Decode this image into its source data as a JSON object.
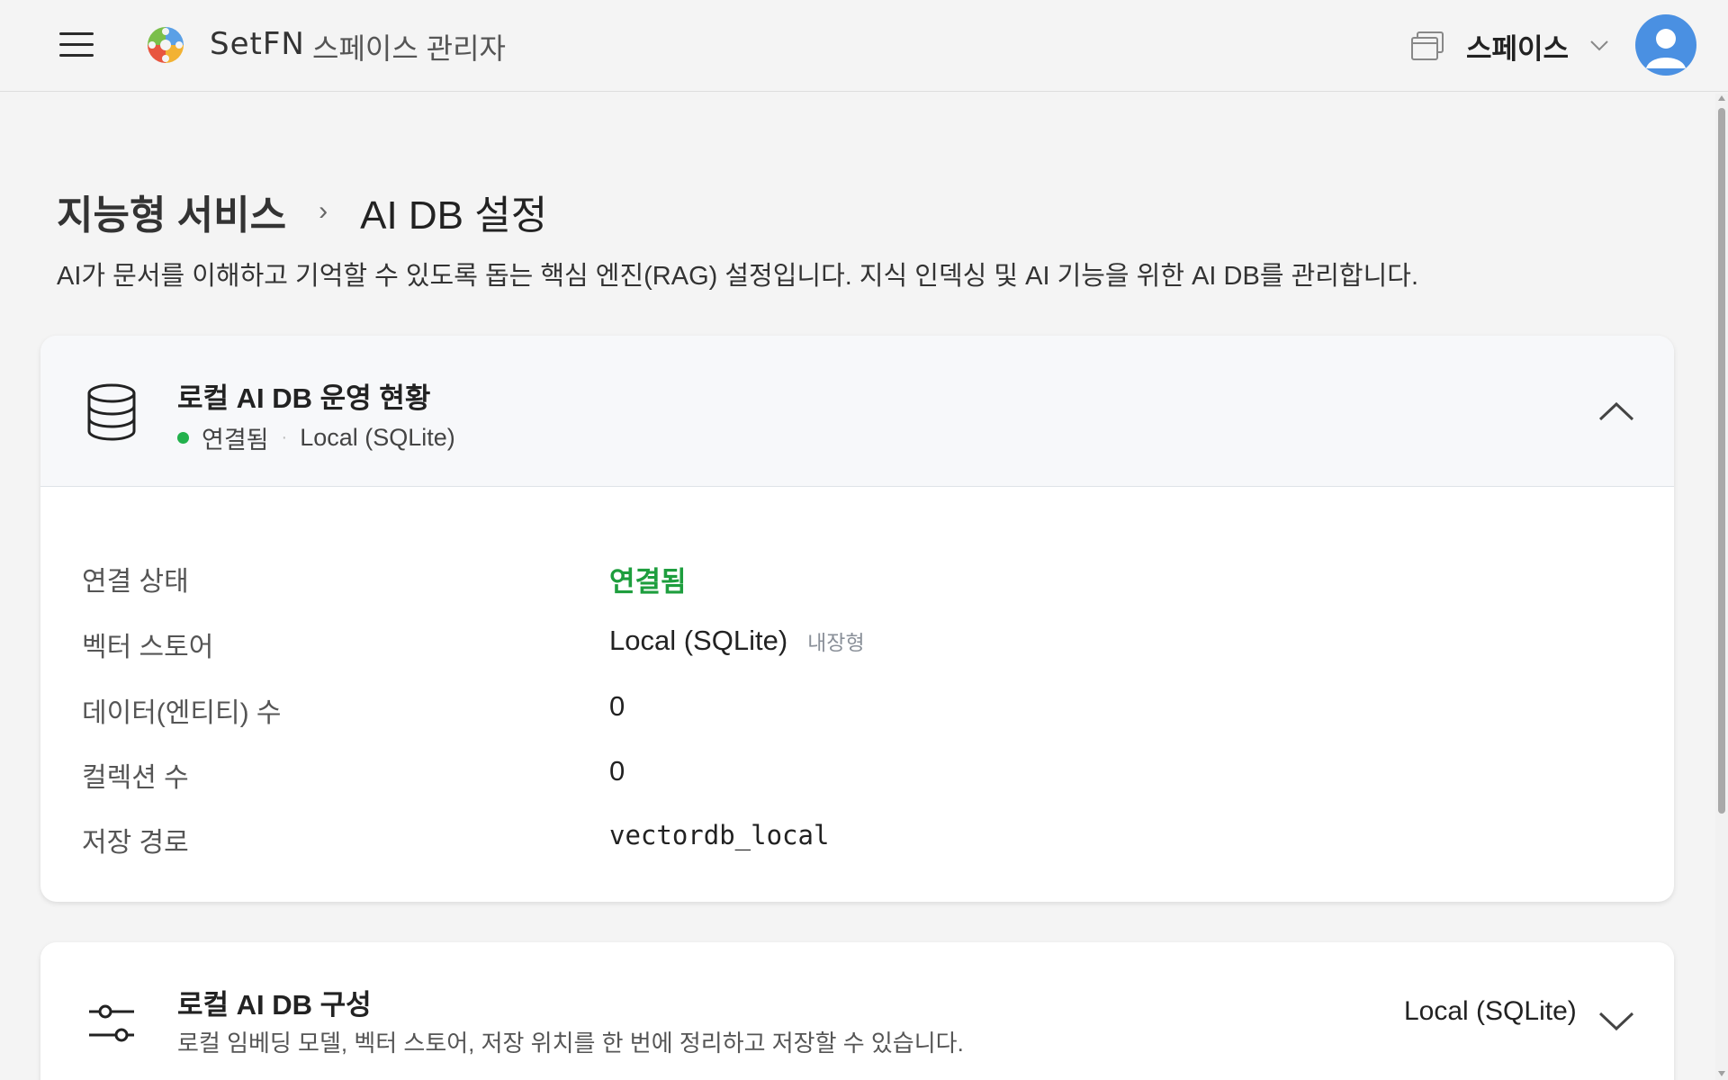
{
  "header": {
    "brand_name": "SetFN",
    "brand_sub": "스페이스 관리자",
    "space_label": "스페이스",
    "icons": [
      "menu-icon",
      "logo-icon",
      "window-stack-icon",
      "chevron-down-icon",
      "user-avatar-icon"
    ]
  },
  "breadcrumb": {
    "parent": "지능형 서비스",
    "separator": "›",
    "current": "AI DB 설정"
  },
  "description": "AI가 문서를 이해하고 기억할 수 있도록 돕는 핵심 엔진(RAG) 설정입니다. 지식 인덱싱 및 AI 기능을 위한 AI DB를 관리합니다.",
  "status_card": {
    "title": "로컬 AI DB 운영 현황",
    "status_text": "연결됨",
    "status_sep": "·",
    "backend": "Local (SQLite)",
    "status_color": "#22b14c",
    "rows": [
      {
        "label": "연결 상태",
        "value": "연결됨",
        "tag": ""
      },
      {
        "label": "벡터 스토어",
        "value": "Local (SQLite)",
        "tag": "내장형"
      },
      {
        "label": "데이터(엔티티) 수",
        "value": "0",
        "tag": ""
      },
      {
        "label": "컬렉션 수",
        "value": "0",
        "tag": ""
      },
      {
        "label": "저장 경로",
        "value": "vectordb_local",
        "tag": ""
      }
    ],
    "expanded": true
  },
  "config_card": {
    "title": "로컬 AI DB 구성",
    "subtitle": "로컬 임베딩 모델, 벡터 스토어, 저장 위치를 한 번에 정리하고 저장할 수 있습니다.",
    "selected": "Local (SQLite)",
    "expanded": false
  },
  "colors": {
    "accent_success": "#1e9e3e",
    "avatar_bg": "#4a90e2",
    "page_bg": "#f4f4f4"
  }
}
